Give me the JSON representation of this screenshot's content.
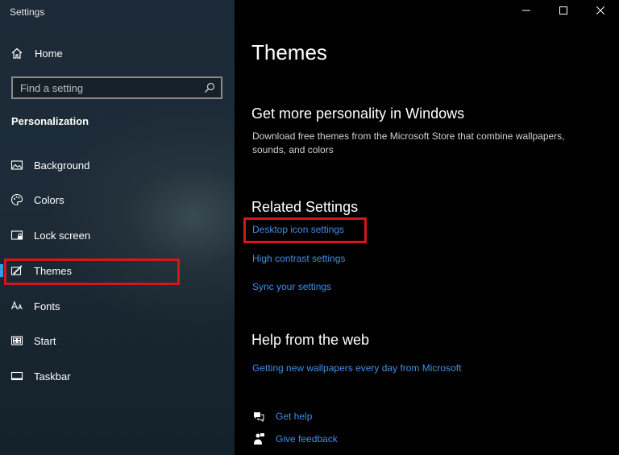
{
  "app": {
    "title": "Settings"
  },
  "sidebar": {
    "home_label": "Home",
    "search": {
      "placeholder": "Find a setting"
    },
    "section_title": "Personalization",
    "items": [
      {
        "label": "Background",
        "icon": "picture-icon"
      },
      {
        "label": "Colors",
        "icon": "palette-icon"
      },
      {
        "label": "Lock screen",
        "icon": "lock-screen-icon"
      },
      {
        "label": "Themes",
        "icon": "themes-brush-icon",
        "selected": true
      },
      {
        "label": "Fonts",
        "icon": "fonts-icon"
      },
      {
        "label": "Start",
        "icon": "start-icon"
      },
      {
        "label": "Taskbar",
        "icon": "taskbar-icon"
      }
    ]
  },
  "main": {
    "title": "Themes",
    "personality": {
      "heading": "Get more personality in Windows",
      "description": "Download free themes from the Microsoft Store that combine wallpapers, sounds, and colors"
    },
    "related": {
      "heading": "Related Settings",
      "links": [
        "Desktop icon settings",
        "High contrast settings",
        "Sync your settings"
      ]
    },
    "help_web": {
      "heading": "Help from the web",
      "link": "Getting new wallpapers every day from Microsoft"
    },
    "get_help": "Get help",
    "give_feedback": "Give feedback"
  },
  "colors": {
    "accent": "#2aa0e8",
    "link": "#3f8fe6",
    "highlight": "#d8141d"
  }
}
